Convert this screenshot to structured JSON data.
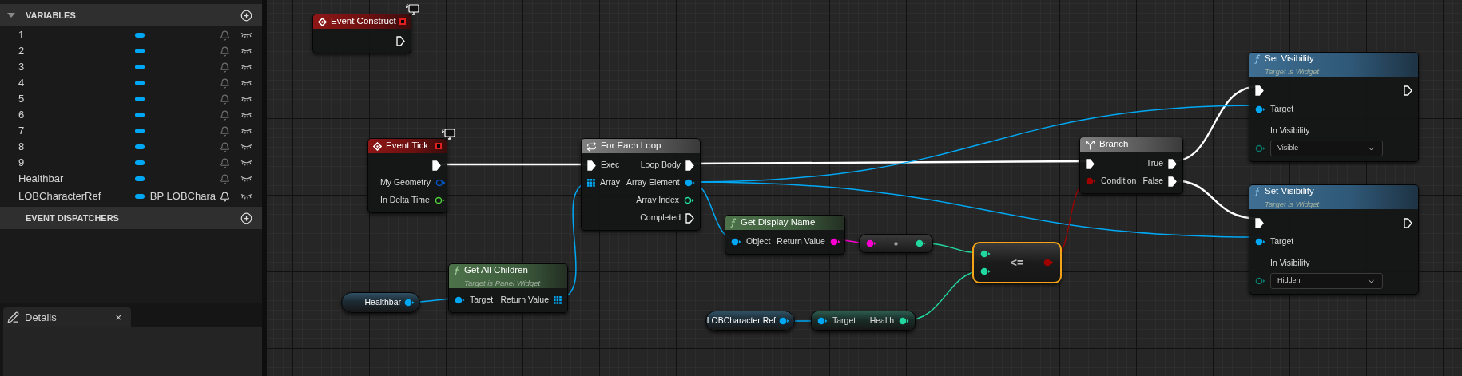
{
  "sidebar": {
    "variables": {
      "title": "VARIABLES",
      "expanded": true,
      "items": [
        {
          "name": "1"
        },
        {
          "name": "2"
        },
        {
          "name": "3"
        },
        {
          "name": "4"
        },
        {
          "name": "5"
        },
        {
          "name": "6"
        },
        {
          "name": "7"
        },
        {
          "name": "8"
        },
        {
          "name": "9"
        },
        {
          "name": "Healthbar"
        },
        {
          "name": "LOBCharacterRef",
          "type_label": "BP LOBChara"
        }
      ]
    },
    "event_dispatchers": {
      "title": "EVENT DISPATCHERS"
    }
  },
  "details_panel": {
    "tab": "Details",
    "close": "×"
  },
  "graph": {
    "nodes": [
      {
        "kind": "event",
        "title": "Event Construct",
        "selected": false,
        "rows": [
          {
            "right": {
              "kind": "exec",
              "connected": false
            }
          }
        ]
      },
      {
        "kind": "event",
        "title": "Event Tick",
        "selected": false,
        "rows": [
          {
            "right": {
              "kind": "exec",
              "connected": true
            }
          },
          {
            "right": {
              "kind": "struct",
              "label": "My Geometry",
              "connected": false
            }
          },
          {
            "right": {
              "kind": "float",
              "label": "In Delta Time",
              "connected": false
            }
          }
        ]
      },
      {
        "kind": "macro",
        "title": "For Each Loop",
        "selected": false,
        "rows": [
          {
            "left": {
              "kind": "exec",
              "label": "Exec",
              "connected": true
            },
            "right": {
              "kind": "exec",
              "label": "Loop Body",
              "connected": true
            }
          },
          {
            "left": {
              "kind": "array",
              "label": "Array",
              "connected": true
            },
            "right": {
              "kind": "object",
              "label": "Array Element",
              "connected": true
            }
          },
          {
            "right": {
              "kind": "int",
              "label": "Array Index",
              "connected": false
            }
          },
          {
            "right": {
              "kind": "exec",
              "label": "Completed",
              "connected": false
            }
          }
        ]
      },
      {
        "kind": "variable",
        "title": "Healthbar",
        "selected": false,
        "outputs": [
          {
            "kind": "object",
            "connected": true
          }
        ]
      },
      {
        "kind": "pure_function",
        "title": "Get All Children",
        "subtitle": "Target is Panel Widget",
        "selected": false,
        "rows": [
          {
            "left": {
              "kind": "object",
              "label": "Target",
              "connected": true
            },
            "right": {
              "kind": "array",
              "label": "Return Value",
              "connected": true
            }
          }
        ]
      },
      {
        "kind": "pure_function",
        "title": "Get Display Name",
        "selected": false,
        "rows": [
          {
            "left": {
              "kind": "object",
              "label": "Object",
              "connected": true
            },
            "right": {
              "kind": "string",
              "label": "Return Value",
              "connected": true
            }
          }
        ]
      },
      {
        "kind": "conversion",
        "selected": false,
        "inputs": [
          {
            "kind": "string",
            "connected": true
          }
        ],
        "outputs": [
          {
            "kind": "real",
            "connected": true
          }
        ]
      },
      {
        "kind": "operator",
        "symbol": "<=",
        "selected": true,
        "inputs": [
          {
            "kind": "real",
            "connected": true
          },
          {
            "kind": "real",
            "connected": true
          }
        ],
        "outputs": [
          {
            "kind": "bool",
            "connected": true
          }
        ]
      },
      {
        "kind": "variable",
        "title": "LOBCharacter Ref",
        "selected": false,
        "outputs": [
          {
            "kind": "object",
            "connected": true
          }
        ]
      },
      {
        "kind": "member_getter",
        "selected": false,
        "rows": [
          {
            "left": {
              "kind": "object",
              "label": "Target",
              "connected": true
            },
            "right": {
              "kind": "real",
              "label": "Health",
              "connected": true
            }
          }
        ]
      },
      {
        "kind": "branch",
        "title": "Branch",
        "selected": false,
        "rows": [
          {
            "left": {
              "kind": "exec",
              "connected": true
            },
            "right": {
              "kind": "exec",
              "label": "True",
              "connected": true
            }
          },
          {
            "left": {
              "kind": "bool",
              "label": "Condition",
              "connected": true
            },
            "right": {
              "kind": "exec",
              "label": "False",
              "connected": true
            }
          }
        ]
      },
      {
        "kind": "function",
        "title": "Set Visibility",
        "subtitle": "Target is Widget",
        "selected": false,
        "rows": [
          {
            "left": {
              "kind": "exec",
              "connected": true
            },
            "right": {
              "kind": "exec",
              "connected": false
            }
          },
          {
            "left": {
              "kind": "object",
              "label": "Target",
              "connected": true
            }
          },
          {
            "left": {
              "kind": "enum",
              "label": "In Visibility",
              "connected": false,
              "value": "Visible"
            }
          }
        ]
      },
      {
        "kind": "function",
        "title": "Set Visibility",
        "subtitle": "Target is Widget",
        "selected": false,
        "rows": [
          {
            "left": {
              "kind": "exec",
              "connected": true
            },
            "right": {
              "kind": "exec",
              "connected": false
            }
          },
          {
            "left": {
              "kind": "object",
              "label": "Target",
              "connected": true
            }
          },
          {
            "left": {
              "kind": "enum",
              "label": "In Visibility",
              "connected": false,
              "value": "Hidden"
            }
          }
        ]
      }
    ]
  }
}
